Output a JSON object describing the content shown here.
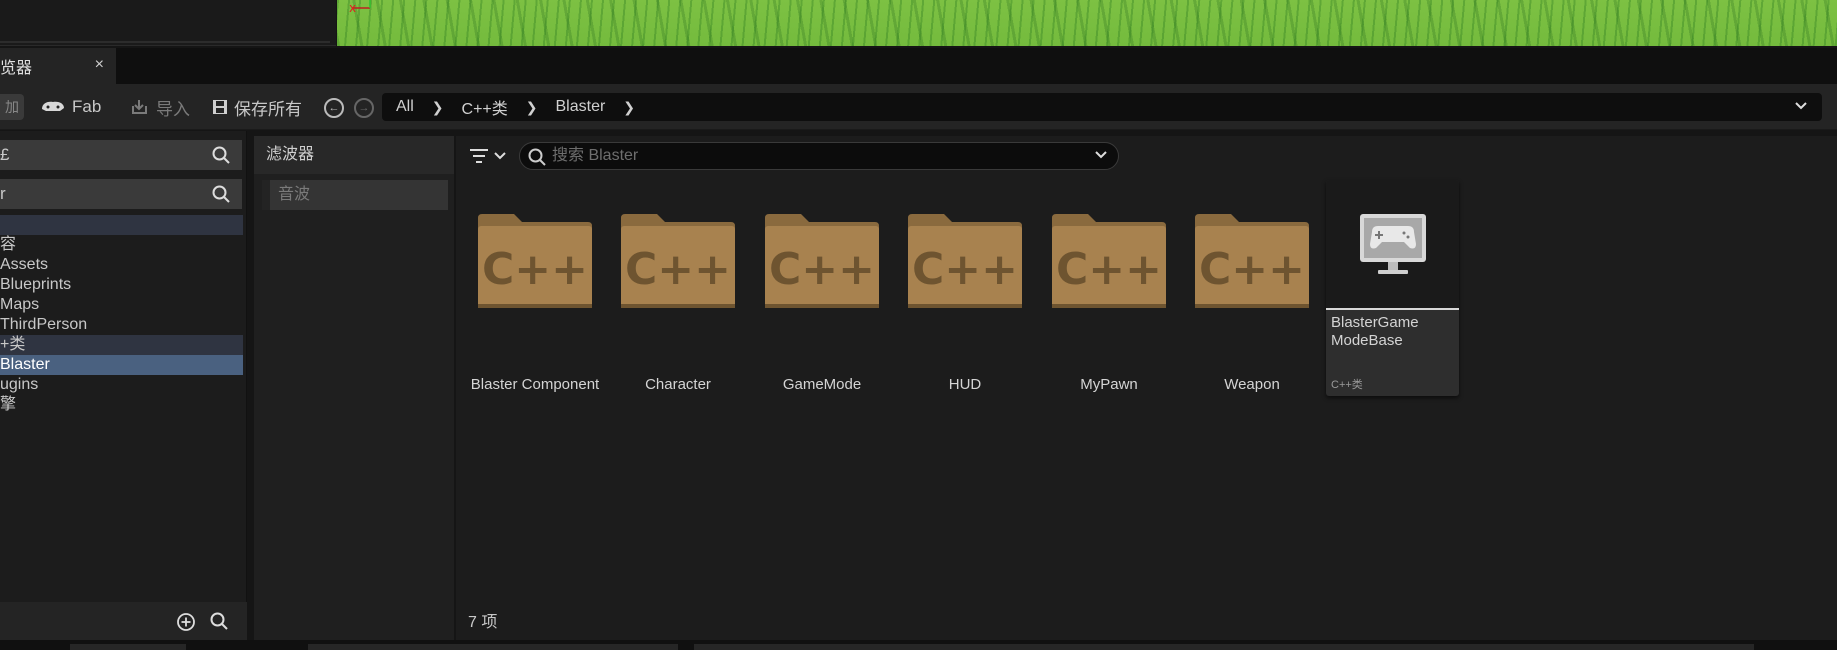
{
  "panel_tab": {
    "label": "览器",
    "close": "×"
  },
  "toolbar": {
    "add_label": "加",
    "fab_label": "Fab",
    "import_label": "导入",
    "save_all_label": "保存所有"
  },
  "breadcrumb": [
    "All",
    "C++类",
    "Blaster"
  ],
  "tree": {
    "search1": "£",
    "search2": "r",
    "items": [
      {
        "label": "",
        "state": "hl"
      },
      {
        "label": "容",
        "state": ""
      },
      {
        "label": "Assets",
        "state": ""
      },
      {
        "label": "Blueprints",
        "state": ""
      },
      {
        "label": "Maps",
        "state": ""
      },
      {
        "label": "ThirdPerson",
        "state": ""
      },
      {
        "label": "+类",
        "state": "hl"
      },
      {
        "label": "Blaster",
        "state": "sel"
      },
      {
        "label": "ugins",
        "state": ""
      },
      {
        "label": "擎",
        "state": ""
      }
    ]
  },
  "filters": {
    "title": "滤波器",
    "item": "音波"
  },
  "search": {
    "placeholder": "搜索 Blaster"
  },
  "folders": [
    {
      "name": "Blaster Component",
      "icon_text": "C++"
    },
    {
      "name": "Character",
      "icon_text": "C++"
    },
    {
      "name": "GameMode",
      "icon_text": "C++"
    },
    {
      "name": "HUD",
      "icon_text": "C++"
    },
    {
      "name": "MyPawn",
      "icon_text": "C++"
    },
    {
      "name": "Weapon",
      "icon_text": "C++"
    }
  ],
  "asset": {
    "name": "BlasterGame ModeBase",
    "type": "C++类"
  },
  "item_count": "7 项",
  "colors": {
    "folder": "#a8824f",
    "folder_dark": "#8a6a3e",
    "selection": "#4a6180"
  }
}
